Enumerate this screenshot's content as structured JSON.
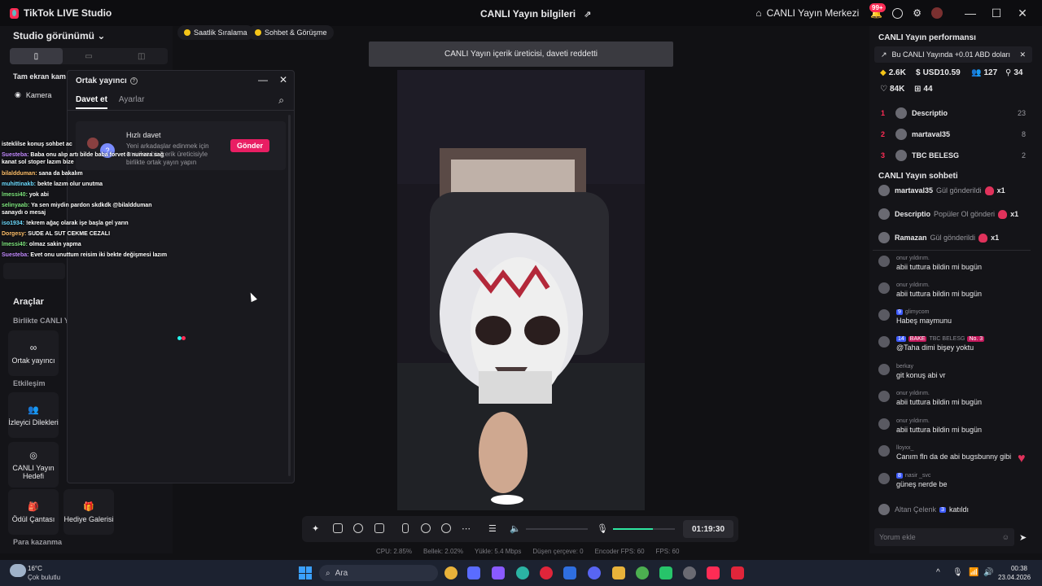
{
  "titlebar": {
    "app_name": "TikTok LIVE Studio",
    "center_title": "CANLI Yayın bilgileri",
    "live_center": "CANLI Yayın Merkezi",
    "notif_badge": "99+"
  },
  "left": {
    "studio_view": "Studio görünümü",
    "fullscreen_label": "Tam ekran kam",
    "camera_label": "Kamera",
    "tools_heading": "Araçlar",
    "together_live": "Birlikte CANLI Yay",
    "cohost_label": "Ortak yayıncı",
    "interaction_heading": "Etkileşim",
    "viewer_requests": "İzleyici Dilekleri",
    "live_goal": "CANLI Yayın Hedefi",
    "reward_bag": "Ödül Çantası",
    "gift_gallery": "Hediye Galerisi",
    "monetize_heading": "Para kazanma"
  },
  "chips": {
    "hourly": "Saatlik Sıralama",
    "chat_meet": "Sohbet & Görüşme"
  },
  "overlay_chat": [
    {
      "user": "",
      "text": "isteklilse konuş sohbet ac",
      "cls": ""
    },
    {
      "user": "Suesteba:",
      "text": "Baba onu alıp artı bilde baba forvet 8 numara sağ kanat sol stoper lazım bize",
      "cls": "u1"
    },
    {
      "user": "bilaldduman:",
      "text": "sana da bakalım",
      "cls": "u3"
    },
    {
      "user": "muhittinakb:",
      "text": "bekte lazım olur unutma",
      "cls": "u2"
    },
    {
      "user": "lmessi40:",
      "text": "yok abi",
      "cls": "u4"
    },
    {
      "user": "selinyaab:",
      "text": "Ya sen miydin pardon skdkdk @bilaldduman sanaydı o mesaj",
      "cls": "u4"
    },
    {
      "user": "iso1934:",
      "text": "!ekrem ağaç olarak işe başla gel yarın",
      "cls": "u2"
    },
    {
      "user": "Dorgesy:",
      "text": "SUDE AL SUT CEKME CEZALI",
      "cls": "u3"
    },
    {
      "user": "lmessi40:",
      "text": "olmaz sakin yapma",
      "cls": "u4"
    },
    {
      "user": "Suesteba:",
      "text": "Evet onu unuttum reisim iki bekte değişmesi lazım",
      "cls": "u1"
    }
  ],
  "dialog": {
    "title": "Ortak yayıncı",
    "tab_invite": "Davet et",
    "tab_settings": "Ayarlar",
    "quick_title": "Hızlı davet",
    "quick_desc": "Yeni arkadaşlar edinmek için önerilen bir içerik üreticisiyle birlikte ortak yayın yapın",
    "send": "Gönder"
  },
  "stream": {
    "notification": "CANLI Yayın içerik üreticisi, daveti reddetti",
    "timer": "01:19:30"
  },
  "stats": {
    "cpu": "CPU: 2.85%",
    "memory": "Bellek: 2.02%",
    "upload": "Yükle: 5.4 Mbps",
    "dropped": "Düşen çerçeve: 0",
    "encoder_fps": "Encoder FPS: 60",
    "fps": "FPS: 60"
  },
  "right": {
    "perf_title": "CANLI Yayın performansı",
    "earn_text": "Bu CANLI Yayında +0.01 ABD doları",
    "diamonds": "2.6K",
    "usd": "USD10.59",
    "viewers": "127",
    "followers": "34",
    "likes": "84K",
    "gifters": "44",
    "ranking": [
      {
        "rank": "1",
        "name": "Descriptio",
        "score": "23"
      },
      {
        "rank": "2",
        "name": "martaval35",
        "score": "8"
      },
      {
        "rank": "3",
        "name": "TBC BELESG",
        "score": "2"
      }
    ],
    "chat_title": "CANLI Yayın sohbeti",
    "gifts": [
      {
        "name": "martaval35",
        "action": "Gül gönderildi",
        "count": "x1"
      },
      {
        "name": "Descriptio",
        "action": "Popüler Ol gönderi",
        "count": "x1"
      },
      {
        "name": "Ramazan",
        "action": "Gül gönderildi",
        "count": "x1"
      }
    ],
    "messages": [
      {
        "user": "onur yıldırım.",
        "level": "",
        "text": "abii tuttura bildin mi bugün"
      },
      {
        "user": "onur yıldırım.",
        "level": "",
        "text": "abii tuttura bildin mi bugün"
      },
      {
        "user": "glimycom",
        "level": "9",
        "text": "Habeş maymunu"
      },
      {
        "user": "TBC BELESG",
        "level": "14",
        "text": "@Taha dimi bişey yoktu"
      },
      {
        "user": "berkay",
        "level": "",
        "text": "git konuş abi vr"
      },
      {
        "user": "onur yıldırım.",
        "level": "",
        "text": "abii tuttura bildin mi bugün"
      },
      {
        "user": "onur yıldırım.",
        "level": "",
        "text": "abii tuttura bildin mi bugün"
      },
      {
        "user": "lloyxx_",
        "level": "",
        "text": "Canım fln da de abi bugsbunny gibi"
      },
      {
        "user": "nasir _svc",
        "level": "8",
        "text": "güneş nerde be"
      }
    ],
    "joined_user": "Altan Çelenk",
    "joined_level": "3",
    "joined_text": "katıldı",
    "comment_placeholder": "Yorum ekle",
    "badge_bake": "BAKE",
    "badge_no3": "No. 3"
  },
  "taskbar": {
    "weather_temp": "16°C",
    "weather_desc": "Çok bulutlu",
    "search": "Ara",
    "time": "00:38",
    "date": "23.04.2026"
  }
}
